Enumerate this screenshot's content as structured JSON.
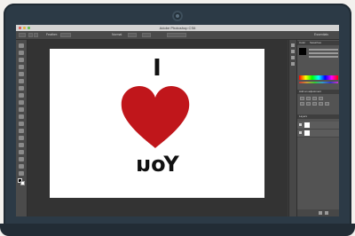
{
  "window": {
    "title": "Adobe Photoshop CS6"
  },
  "options_bar": {
    "feather_label": "Feather:",
    "style_value": "Normal",
    "workspace_value": "Essentials"
  },
  "canvas": {
    "line1": "I",
    "line3": "You",
    "heart_color": "#c0161b"
  },
  "panels": {
    "tabs": [
      "Color",
      "Swatches"
    ],
    "adjustments_title": "Add an adjustment",
    "layers_title": "Layers"
  },
  "colors": {
    "laptop_bezel": "#2c3a46",
    "workspace_bg": "#333333",
    "panel_bg": "#535353"
  }
}
